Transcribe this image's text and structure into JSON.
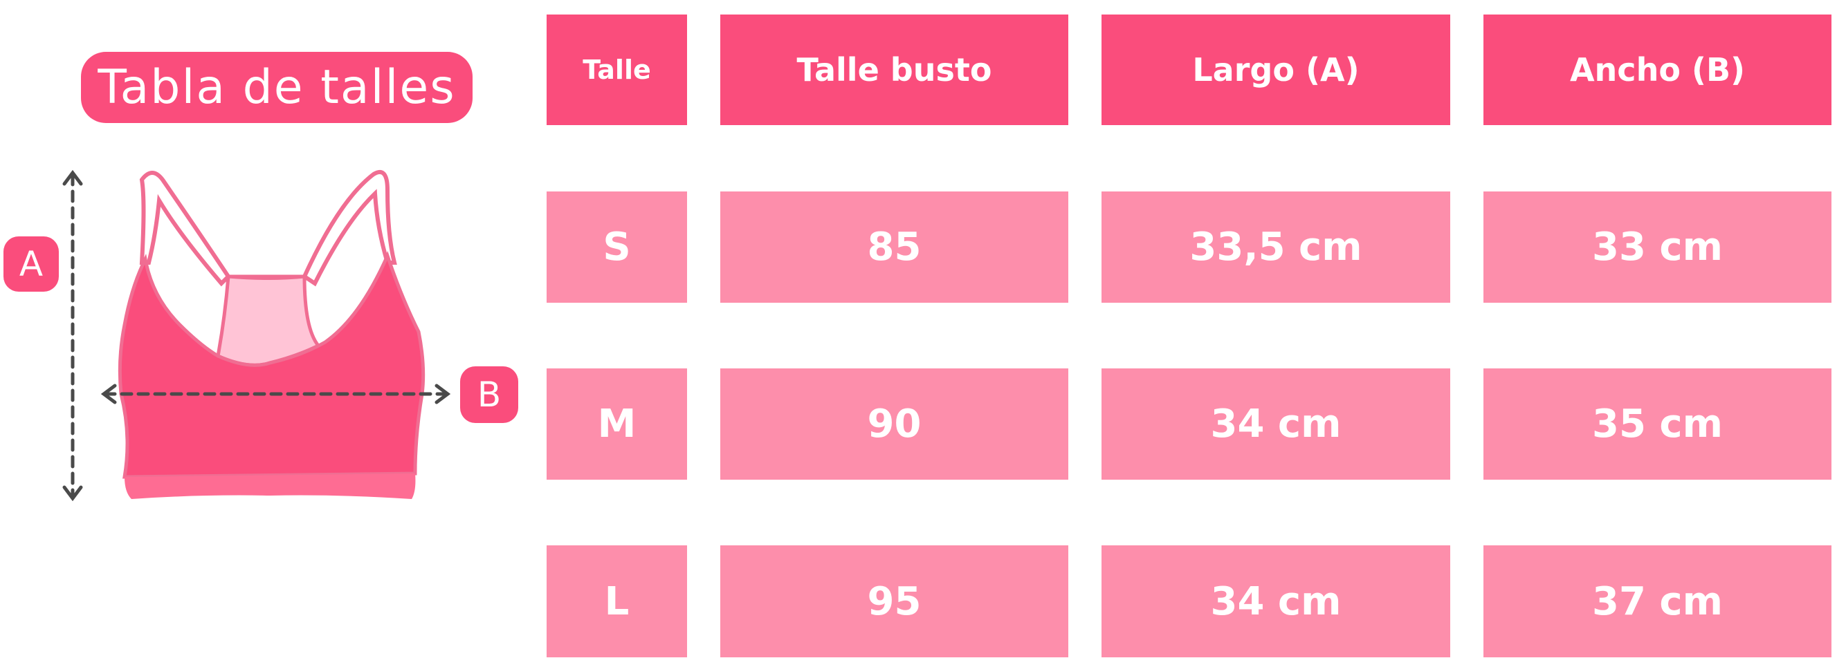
{
  "title": "Tabla de talles",
  "labels": {
    "a": "A",
    "b": "B"
  },
  "colors": {
    "header": "#fa4d7c",
    "cell": "#fd8eab",
    "garment": "#fa4d7c",
    "garment_back": "#ffc4d6",
    "arrow": "#4a4a4a"
  },
  "table": {
    "headers": [
      "Talle",
      "Talle busto",
      "Largo (A)",
      "Ancho (B)"
    ],
    "rows": [
      [
        "S",
        "85",
        "33,5 cm",
        "33 cm"
      ],
      [
        "M",
        "90",
        "34 cm",
        "35 cm"
      ],
      [
        "L",
        "95",
        "34 cm",
        "37 cm"
      ]
    ]
  }
}
